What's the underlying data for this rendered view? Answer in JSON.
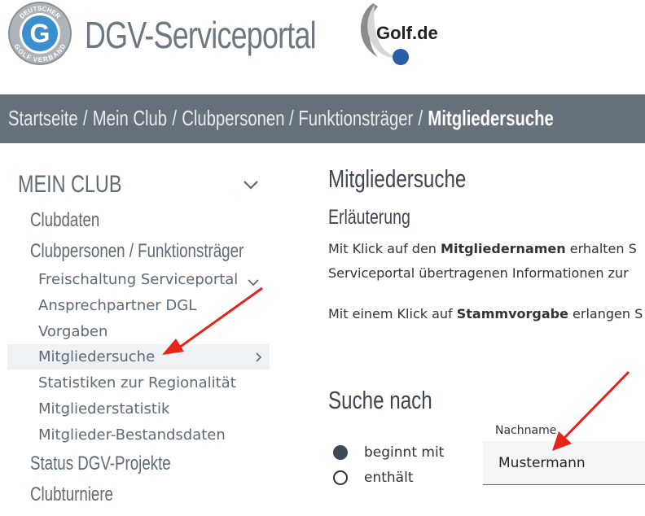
{
  "header": {
    "portal_title": "DGV-Serviceportal",
    "seal_text_top": "DEUTSCHER",
    "seal_text_bottom": "GOLF VERBAND",
    "seal_letter": "G",
    "golf_logo_text": "Golf.de"
  },
  "breadcrumb": {
    "items": [
      "Startseite",
      "Mein Club",
      "Clubpersonen / Funktionsträger"
    ],
    "separator": "/",
    "current": "Mitgliedersuche"
  },
  "sidebar": {
    "heading": "MEIN CLUB",
    "items": [
      {
        "label": "Clubdaten"
      },
      {
        "label": "Clubpersonen / Funktionsträger"
      }
    ],
    "subitems": [
      {
        "label": "Freischaltung Serviceportal"
      },
      {
        "label": "Ansprechpartner DGL"
      },
      {
        "label": "Vorgaben"
      },
      {
        "label": "Mitgliedersuche"
      },
      {
        "label": "Statistiken zur Regionalität"
      },
      {
        "label": "Mitgliederstatistik"
      },
      {
        "label": "Mitglieder-Bestandsdaten"
      }
    ],
    "bottom_items": [
      {
        "label": "Status DGV-Projekte"
      },
      {
        "label": "Clubturniere"
      }
    ]
  },
  "main": {
    "title": "Mitgliedersuche",
    "subtitle": "Erläuterung",
    "para1_pre": "Mit Klick auf den ",
    "para1_bold": "Mitgliedernamen",
    "para1_post": " erhalten S",
    "para2": "Serviceportal übertragenen Informationen zur",
    "para3_pre": "Mit einem Klick auf ",
    "para3_bold": "Stammvorgabe",
    "para3_post": " erlangen S",
    "search_title": "Suche nach",
    "radio_begins": "beginnt mit",
    "radio_contains": "enthält",
    "field_label": "Nachname",
    "field_value": "Mustermann"
  },
  "colors": {
    "breadcrumb_bg": "#66717c",
    "accent_blue": "#2a5ea8",
    "arrow_red": "#e8231a"
  }
}
